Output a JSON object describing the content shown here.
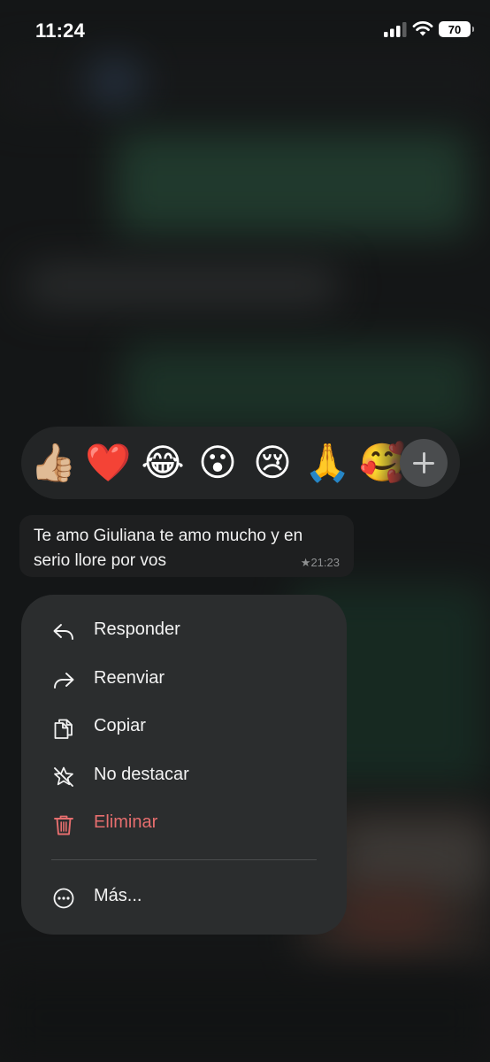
{
  "status_bar": {
    "time": "11:24",
    "battery": "70"
  },
  "reaction_bar": {
    "emojis": [
      {
        "name": "thumbs-up",
        "glyph": "👍🏼"
      },
      {
        "name": "red-heart",
        "glyph": "❤️"
      },
      {
        "name": "tears-of-joy",
        "glyph": "😂"
      },
      {
        "name": "surprised",
        "glyph": "😮"
      },
      {
        "name": "crying",
        "glyph": "😢"
      },
      {
        "name": "folded-hands",
        "glyph": "🙏"
      },
      {
        "name": "smiling-with-hearts",
        "glyph": "🥰"
      }
    ],
    "more_icon": "plus-icon"
  },
  "message": {
    "text": "Te amo Giuliana te amo mucho y en serio llore por vos",
    "star": "★",
    "time": "21:23"
  },
  "menu": {
    "items": [
      {
        "label": "Responder",
        "icon": "reply-icon"
      },
      {
        "label": "Reenviar",
        "icon": "forward-icon"
      },
      {
        "label": "Copiar",
        "icon": "copy-icon"
      },
      {
        "label": "No destacar",
        "icon": "unstar-icon"
      },
      {
        "label": "Eliminar",
        "icon": "trash-icon",
        "color": "#e66e6e"
      }
    ],
    "more": {
      "label": "Más...",
      "icon": "more-icon"
    }
  },
  "colors": {
    "background": "#1a1b1c",
    "menu": "#2b2d2e",
    "danger": "#e66e6e",
    "chat_green": "#2f5a44"
  }
}
